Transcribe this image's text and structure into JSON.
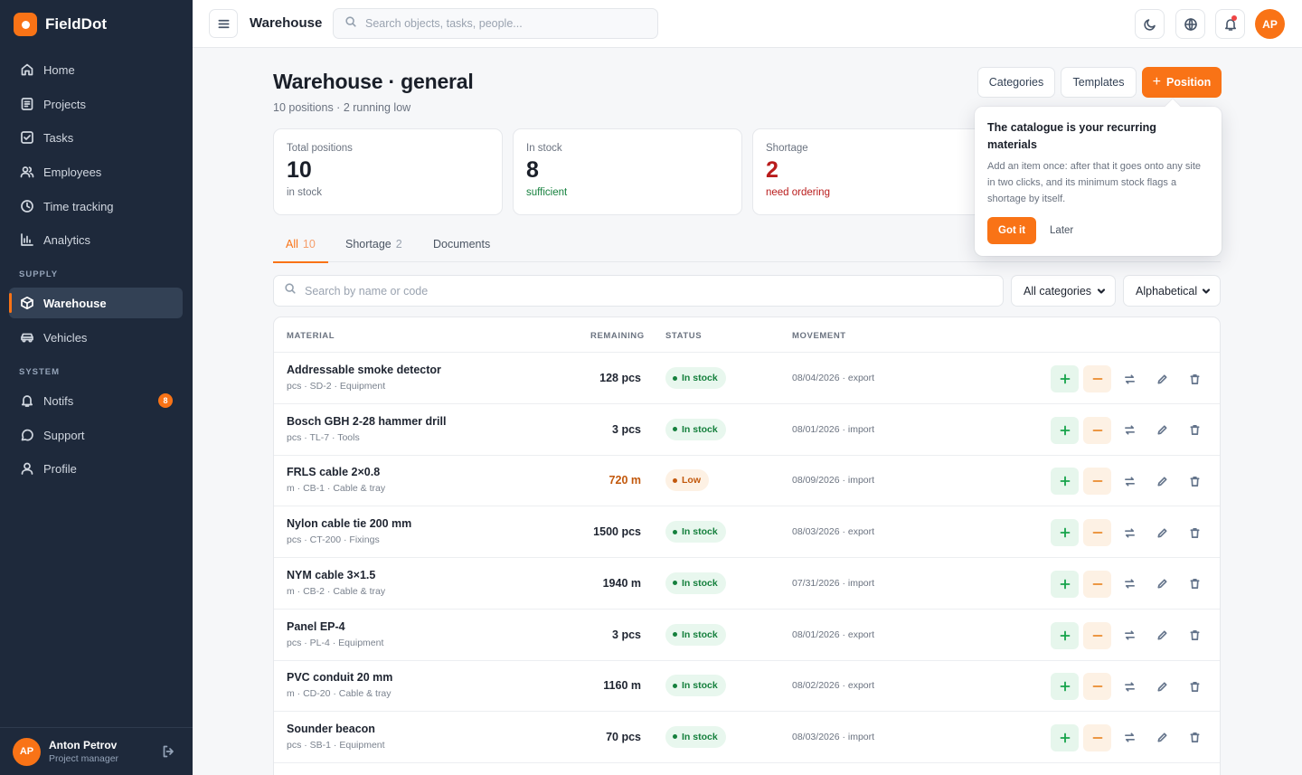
{
  "app": {
    "name": "FieldDot"
  },
  "sidebar": {
    "items_main": [
      {
        "label": "Home",
        "icon": "home-icon"
      },
      {
        "label": "Projects",
        "icon": "projects-icon"
      },
      {
        "label": "Tasks",
        "icon": "tasks-icon"
      },
      {
        "label": "Employees",
        "icon": "employees-icon"
      },
      {
        "label": "Time tracking",
        "icon": "clock-icon"
      },
      {
        "label": "Analytics",
        "icon": "analytics-icon"
      }
    ],
    "section_supply": "SUPPLY",
    "items_supply": [
      {
        "label": "Warehouse",
        "icon": "box-icon",
        "active": true
      },
      {
        "label": "Vehicles",
        "icon": "car-icon"
      }
    ],
    "section_system": "SYSTEM",
    "items_system": [
      {
        "label": "Notifs",
        "icon": "bell-icon",
        "badge": "8"
      },
      {
        "label": "Support",
        "icon": "chat-icon"
      },
      {
        "label": "Profile",
        "icon": "user-icon"
      }
    ],
    "user": {
      "initials": "AP",
      "name": "Anton Petrov",
      "role": "Project manager"
    }
  },
  "topbar": {
    "title": "Warehouse",
    "search_placeholder": "Search objects, tasks, people...",
    "avatar_initials": "AP"
  },
  "page": {
    "title": "Warehouse · general",
    "subtitle": "10 positions · 2 running low",
    "buttons": {
      "categories": "Categories",
      "templates": "Templates",
      "position": "Position"
    }
  },
  "stats": [
    {
      "label": "Total positions",
      "value": "10",
      "note": "in stock",
      "color": "#1a1f29",
      "note_color": "#6b7380"
    },
    {
      "label": "In stock",
      "value": "8",
      "note": "sufficient",
      "color": "#1a1f29",
      "note_color": "#15803d"
    },
    {
      "label": "Shortage",
      "value": "2",
      "note": "need ordering",
      "color": "#b91c1c",
      "note_color": "#b91c1c"
    }
  ],
  "tabs": [
    {
      "label": "All",
      "count": "10",
      "active": true
    },
    {
      "label": "Shortage",
      "count": "2"
    },
    {
      "label": "Documents",
      "count": ""
    }
  ],
  "filters": {
    "search_placeholder": "Search by name or code",
    "category": "All categories",
    "sort": "Alphabetical"
  },
  "table": {
    "headers": {
      "material": "MATERIAL",
      "remaining": "REMAINING",
      "status": "STATUS",
      "movement": "MOVEMENT"
    },
    "rows": [
      {
        "name": "Addressable smoke detector",
        "meta": "pcs · SD-2 · Equipment",
        "qty": "128 pcs",
        "status": "In stock",
        "level": "ok",
        "movement": "08/04/2026 · export"
      },
      {
        "name": "Bosch GBH 2-28 hammer drill",
        "meta": "pcs · TL-7 · Tools",
        "qty": "3 pcs",
        "status": "In stock",
        "level": "ok",
        "movement": "08/01/2026 · import"
      },
      {
        "name": "FRLS cable 2×0.8",
        "meta": "m · CB-1 · Cable & tray",
        "qty": "720 m",
        "status": "Low",
        "level": "low",
        "movement": "08/09/2026 · import"
      },
      {
        "name": "Nylon cable tie 200 mm",
        "meta": "pcs · CT-200 · Fixings",
        "qty": "1500 pcs",
        "status": "In stock",
        "level": "ok",
        "movement": "08/03/2026 · export"
      },
      {
        "name": "NYM cable 3×1.5",
        "meta": "m · CB-2 · Cable & tray",
        "qty": "1940 m",
        "status": "In stock",
        "level": "ok",
        "movement": "07/31/2026 · import"
      },
      {
        "name": "Panel EP-4",
        "meta": "pcs · PL-4 · Equipment",
        "qty": "3 pcs",
        "status": "In stock",
        "level": "ok",
        "movement": "08/01/2026 · export"
      },
      {
        "name": "PVC conduit 20 mm",
        "meta": "m · CD-20 · Cable & tray",
        "qty": "1160 m",
        "status": "In stock",
        "level": "ok",
        "movement": "08/02/2026 · export"
      },
      {
        "name": "Sounder beacon",
        "meta": "pcs · SB-1 · Equipment",
        "qty": "70 pcs",
        "status": "In stock",
        "level": "ok",
        "movement": "08/03/2026 · import"
      }
    ]
  },
  "popover": {
    "title": "The catalogue is your recurring materials",
    "body": "Add an item once: after that it goes onto any site in two clicks, and its minimum stock flags a shortage by itself.",
    "primary": "Got it",
    "secondary": "Later"
  },
  "colors": {
    "accent": "#f97316",
    "sidebar_bg": "#1e293b",
    "ok": "#15803d",
    "low": "#c2580c",
    "danger": "#b91c1c"
  }
}
